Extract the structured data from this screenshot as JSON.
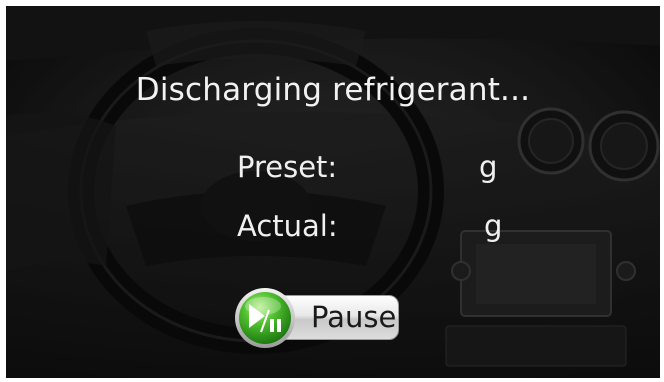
{
  "status": {
    "title": "Discharging refrigerant..."
  },
  "preset": {
    "label": "Preset:",
    "value": "",
    "unit": "g"
  },
  "actual": {
    "label": "Actual:",
    "value": "",
    "unit": "g"
  },
  "controls": {
    "pause_label": "Pause",
    "pause_icon": "play-pause-icon"
  },
  "colors": {
    "text": "#f0f0f0",
    "button_green": "#3fae2a"
  }
}
